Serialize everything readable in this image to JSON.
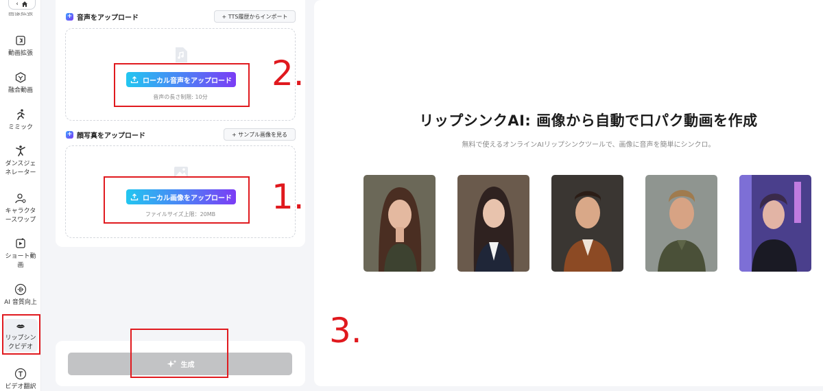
{
  "sidebar": {
    "back_chevron": "‹",
    "cut_label": "画像拡張",
    "items": [
      {
        "icon": "expand-video-icon",
        "label": "動画拡張"
      },
      {
        "icon": "merge-video-icon",
        "label": "融合動画"
      },
      {
        "icon": "running-person-icon",
        "label": "ミミック"
      },
      {
        "icon": "dancer-icon",
        "label": "ダンスジェ\nネレーター"
      },
      {
        "icon": "character-swap-icon",
        "label": "キャラクタ\nースワップ"
      },
      {
        "icon": "short-video-icon",
        "label": "ショート動\n画"
      },
      {
        "icon": "audio-wave-icon",
        "label": "AI 音質向上"
      },
      {
        "icon": "lips-icon",
        "label": "リップシン\nクビデオ"
      },
      {
        "icon": "translate-icon",
        "label": "ビデオ翻訳"
      }
    ]
  },
  "audio_section": {
    "title": "音声をアップロード",
    "import_button": "+ TTS履歴からインポート",
    "upload_button": "ローカル音声をアップロード",
    "hint": "音声の長さ制限: 10分"
  },
  "photo_section": {
    "title": "顔写真をアップロード",
    "sample_button": "+ サンプル画像を見る",
    "upload_button": "ローカル画像をアップロード",
    "hint": "ファイルサイズ上限：20MB"
  },
  "generate": {
    "label": "生成"
  },
  "preview": {
    "title": "リップシンクAI: 画像から自動で口パク動画を作成",
    "subtitle": "無料で使えるオンラインAIリップシンクツールで、画像に音声を簡単にシンクロ。"
  },
  "annotations": {
    "step1": "1.",
    "step2": "2.",
    "step3": "3."
  },
  "colors": {
    "accent_gradient_start": "#22c6f0",
    "accent_gradient_end": "#7b3cf5",
    "annotation_red": "#e0191e",
    "disabled_button": "#c2c3c5"
  }
}
